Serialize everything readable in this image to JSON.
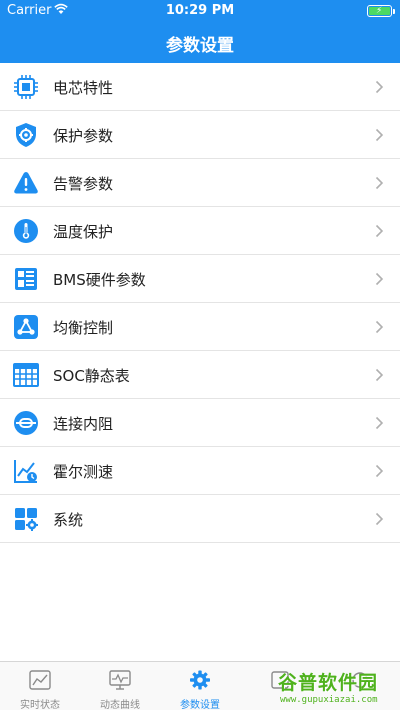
{
  "status_bar": {
    "carrier": "Carrier",
    "time": "10:29 PM"
  },
  "header": {
    "title": "参数设置"
  },
  "menu": {
    "items": [
      {
        "label": "电芯特性",
        "icon": "cpu-chip-icon"
      },
      {
        "label": "保护参数",
        "icon": "shield-gear-icon"
      },
      {
        "label": "告警参数",
        "icon": "warning-triangle-icon"
      },
      {
        "label": "温度保护",
        "icon": "thermometer-icon"
      },
      {
        "label": "BMS硬件参数",
        "icon": "hardware-list-icon"
      },
      {
        "label": "均衡控制",
        "icon": "balance-nodes-icon"
      },
      {
        "label": "SOC静态表",
        "icon": "table-grid-icon"
      },
      {
        "label": "连接内阻",
        "icon": "resistance-icon"
      },
      {
        "label": "霍尔测速",
        "icon": "speed-chart-icon"
      },
      {
        "label": "系统",
        "icon": "system-grid-icon"
      }
    ]
  },
  "tabbar": {
    "tabs": [
      {
        "label": "实时状态",
        "icon": "realtime-chart-icon",
        "active": false
      },
      {
        "label": "动态曲线",
        "icon": "monitor-curve-icon",
        "active": false
      },
      {
        "label": "参数设置",
        "icon": "gear-icon",
        "active": true
      },
      {
        "label": "",
        "icon": "tab-4-icon",
        "active": false
      },
      {
        "label": "",
        "icon": "tab-5-icon",
        "active": false
      }
    ]
  },
  "watermark": {
    "main": "谷普软件园",
    "sub": "www.gupuxiazai.com"
  },
  "colors": {
    "accent": "#1e8ef0",
    "text": "#222222",
    "inactive": "#8a8a8a",
    "watermark": "#4fb21d"
  }
}
